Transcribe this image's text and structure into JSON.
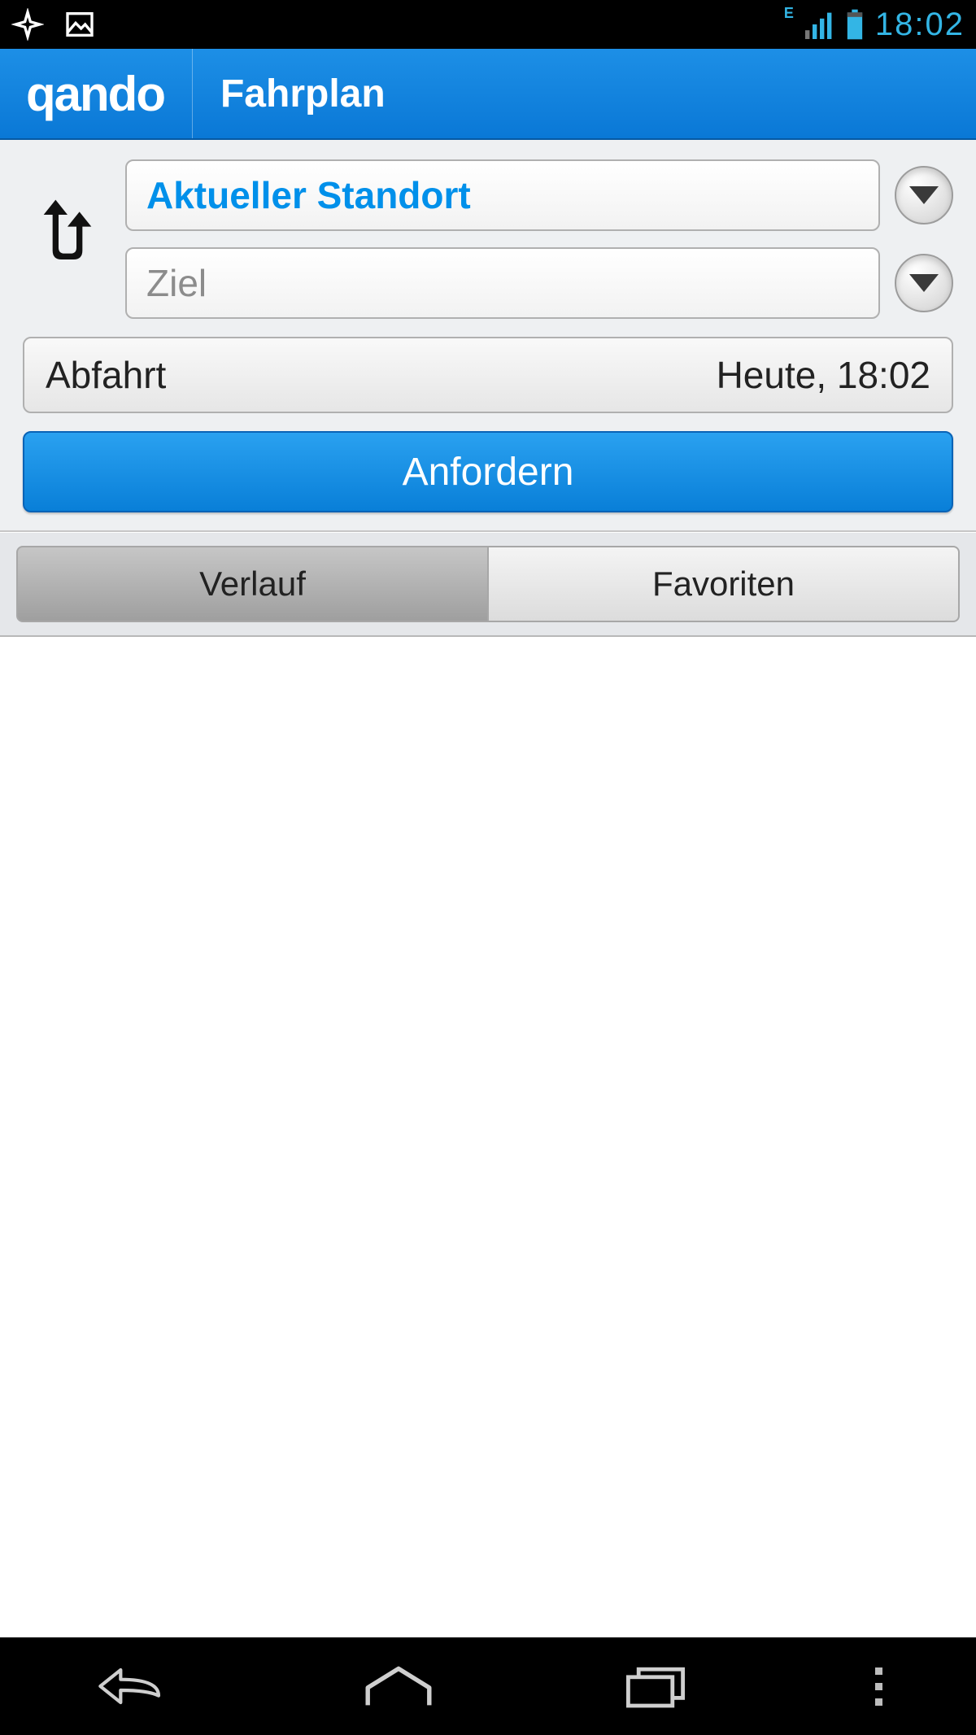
{
  "statusbar": {
    "time": "18:02",
    "indicator_e": "E"
  },
  "appbar": {
    "brand": "qando",
    "title": "Fahrplan"
  },
  "form": {
    "origin_value": "Aktueller Standort",
    "destination_placeholder": "Ziel",
    "time_label": "Abfahrt",
    "time_value": "Heute, 18:02",
    "submit_label": "Anfordern"
  },
  "tabs": {
    "history": "Verlauf",
    "favorites": "Favoriten"
  }
}
